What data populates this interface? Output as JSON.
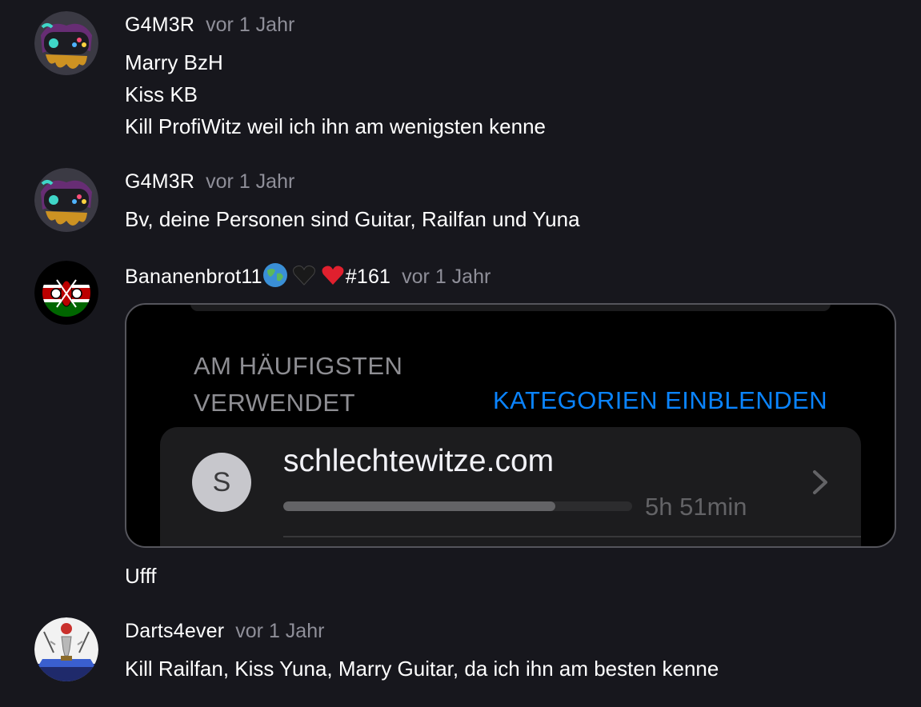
{
  "comments": [
    {
      "username": "G4M3R",
      "time": "vor 1 Jahr",
      "avatar_icon": "gamepad-avatar-icon",
      "lines": [
        "Marry BzH",
        "Kiss KB",
        "Kill ProfiWitz weil ich ihn am wenigsten kenne"
      ]
    },
    {
      "username": "G4M3R",
      "time": "vor 1 Jahr",
      "avatar_icon": "gamepad-avatar-icon",
      "lines": [
        "Bv, deine Personen sind Guitar, Railfan und Yuna"
      ]
    },
    {
      "username": "Bananenbrot11",
      "username_suffix": "#161",
      "emojis": [
        "globe-emoji",
        "black-heart-emoji",
        "red-heart-emoji"
      ],
      "time": "vor 1 Jahr",
      "avatar_icon": "kenya-flag-avatar-icon",
      "attachment": {
        "section_header_line1": "AM HÄUFIGSTEN",
        "section_header_line2": "VERWENDET",
        "show_categories": "KATEGORIEN EINBLENDEN",
        "site_initial": "S",
        "site_name": "schlechtewitze.com",
        "usage_time": "5h 51min",
        "usage_fraction": 0.78
      },
      "lines": [
        "Ufff"
      ]
    },
    {
      "username": "Darts4ever",
      "time": "vor 1 Jahr",
      "avatar_icon": "darts-trophy-avatar-icon",
      "lines": [
        "Kill Railfan, Kiss Yuna, Marry Guitar, da ich ihn am besten kenne"
      ]
    }
  ],
  "colors": {
    "background": "#17171d",
    "timestamp": "#8f8f99",
    "link_blue": "#0a84ff"
  }
}
